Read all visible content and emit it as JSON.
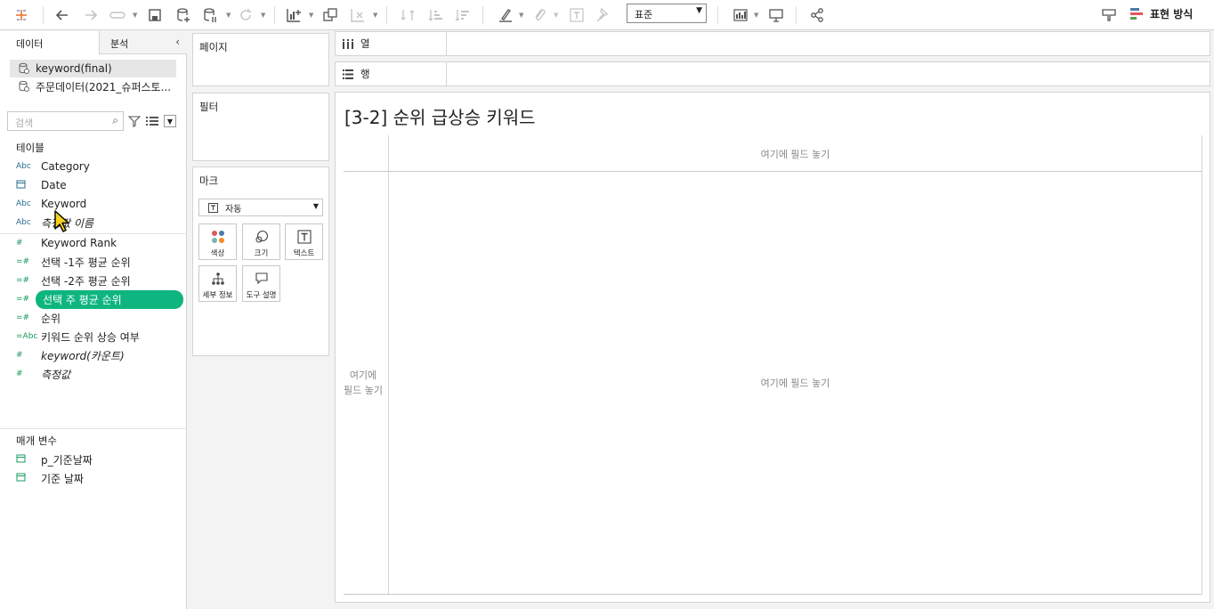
{
  "toolbar": {
    "std_select": "표준",
    "showme_label": "표현 방식"
  },
  "data_pane": {
    "tab_data": "데이터",
    "tab_analysis": "분석",
    "sources": [
      "keyword(final)",
      "주문데이터(2021_슈퍼스토..."
    ],
    "search_placeholder": "검색",
    "tables_title": "테이블",
    "fields": [
      {
        "icon": "Abc",
        "label": "Category"
      },
      {
        "icon": "date",
        "label": "Date"
      },
      {
        "icon": "Abc",
        "label": "Keyword"
      },
      {
        "icon": "Abc",
        "label": "측정값 이름",
        "italic": true
      },
      {
        "icon": "#",
        "label": "Keyword Rank"
      },
      {
        "icon": "=#",
        "label": "선택 -1주 평균 순위"
      },
      {
        "icon": "=#",
        "label": "선택 -2주 평균 순위"
      },
      {
        "icon": "=#",
        "label": "선택 주 평균 순위",
        "highlight": true
      },
      {
        "icon": "=#",
        "label": "순위"
      },
      {
        "icon": "=Abc",
        "label": "키워드 순위 상승 여부"
      },
      {
        "icon": "#",
        "label": "keyword(카운트)",
        "italic": true
      },
      {
        "icon": "#",
        "label": "측정값",
        "italic": true
      }
    ],
    "params_title": "매개 변수",
    "params": [
      {
        "label": "p_기준날짜"
      },
      {
        "label": "기준 날짜"
      }
    ]
  },
  "cards": {
    "pages": "페이지",
    "filters": "필터",
    "marks": "마크",
    "mark_type": "자동",
    "mark_buttons": [
      "색상",
      "크기",
      "텍스트",
      "세부 정보",
      "도구 설명"
    ]
  },
  "shelves": {
    "columns": "열",
    "rows": "행"
  },
  "view": {
    "title": "[3-2] 순위 급상승 키워드",
    "drop_top": "여기에 필드 놓기",
    "drop_left_1": "여기에",
    "drop_left_2": "필드 놓기",
    "drop_center": "여기에 필드 놓기"
  },
  "colors": {
    "highlight": "#0fb57f",
    "field_icon_blue": "#2b6b8f",
    "field_icon_green": "#189a5e"
  }
}
